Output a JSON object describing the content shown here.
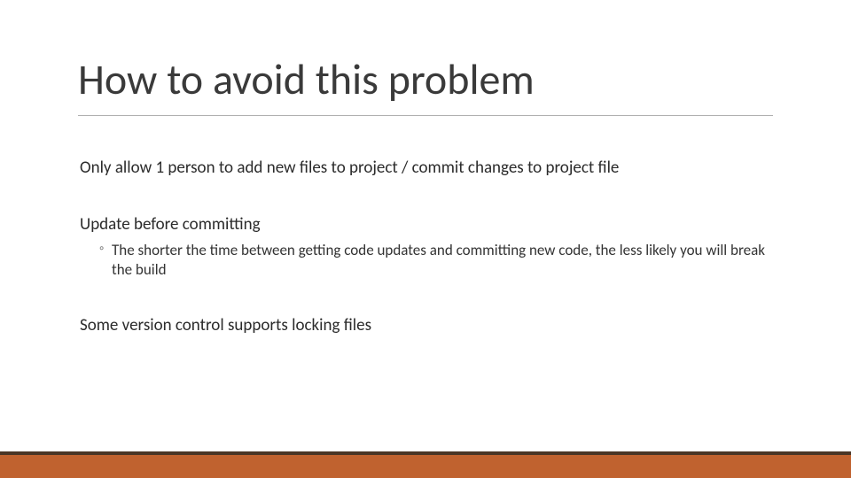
{
  "slide": {
    "title": "How to avoid this problem",
    "points": [
      "Only allow 1 person to add new files to project / commit changes to project file",
      "Update before committing",
      "Some version control supports locking files"
    ],
    "sub_point_bullet": "◦",
    "sub_point": "The shorter the time between getting code updates and committing new code, the less likely you will break the build"
  },
  "theme": {
    "accent_bar": "#c0622f",
    "accent_bar_top": "#4a3626"
  }
}
